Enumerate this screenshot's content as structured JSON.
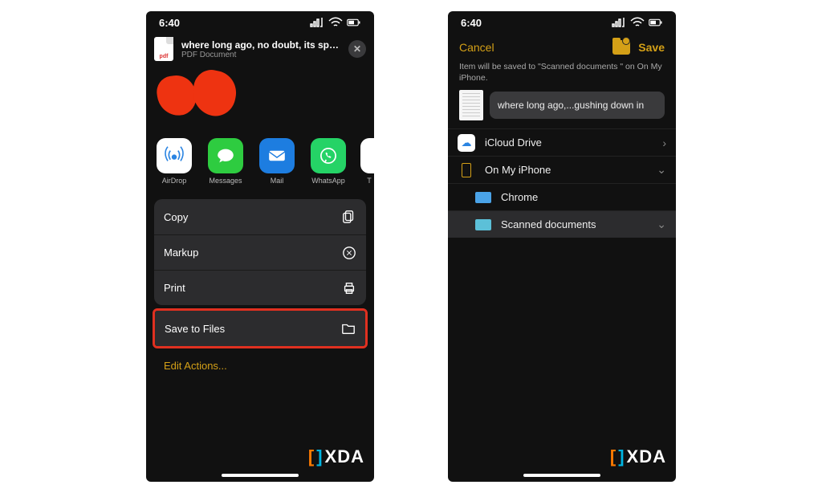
{
  "status": {
    "time": "6:40"
  },
  "share": {
    "doc_title": "where long ago, no doubt, its sprin...",
    "doc_subtitle": "PDF Document",
    "pdf_badge": "pdf",
    "apps": [
      {
        "name": "AirDrop"
      },
      {
        "name": "Messages"
      },
      {
        "name": "Mail"
      },
      {
        "name": "WhatsApp"
      },
      {
        "name": "T"
      }
    ],
    "actions": {
      "copy": "Copy",
      "markup": "Markup",
      "print": "Print",
      "save_to_files": "Save to Files",
      "edit": "Edit Actions..."
    }
  },
  "files": {
    "cancel": "Cancel",
    "save": "Save",
    "hint": "Item will be saved to \"Scanned documents \" on On My iPhone.",
    "filename": "where long ago,...gushing down in",
    "locations": {
      "icloud": "iCloud Drive",
      "onmyiphone": "On My iPhone",
      "chrome": "Chrome",
      "scanned": "Scanned documents"
    }
  },
  "watermark": "XDA"
}
